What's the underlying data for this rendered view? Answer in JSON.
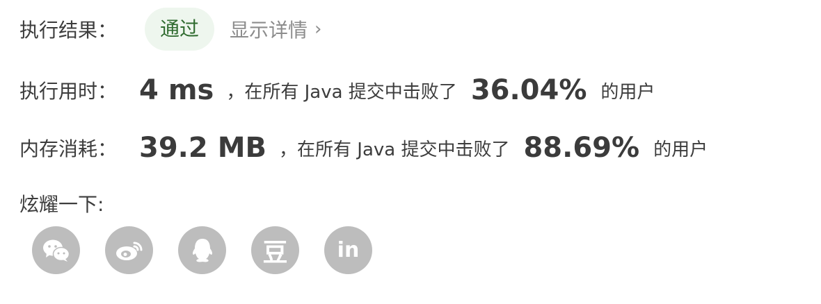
{
  "result": {
    "label": "执行结果：",
    "status": "通过",
    "details_link": "显示详情",
    "chevron": "›"
  },
  "runtime": {
    "label": "执行用时：",
    "value": "4",
    "unit": "ms",
    "description": "，在所有 Java 提交中击败了",
    "percentile": "36.04%",
    "suffix": "的用户"
  },
  "memory": {
    "label": "内存消耗：",
    "value": "39.2",
    "unit": "MB",
    "description": "，在所有 Java 提交中击败了",
    "percentile": "88.69%",
    "suffix": "的用户"
  },
  "share": {
    "label": "炫耀一下:",
    "icons": [
      "wechat-icon",
      "weibo-icon",
      "qq-icon",
      "douban-icon",
      "linkedin-icon"
    ],
    "douban_glyph": "豆",
    "linkedin_glyph": "in",
    "icon_bg_color": "#bdbdbd"
  },
  "colors": {
    "badge_bg": "#eef6ee",
    "badge_text": "#2f6b2f",
    "muted_text": "#8c8c8c"
  }
}
